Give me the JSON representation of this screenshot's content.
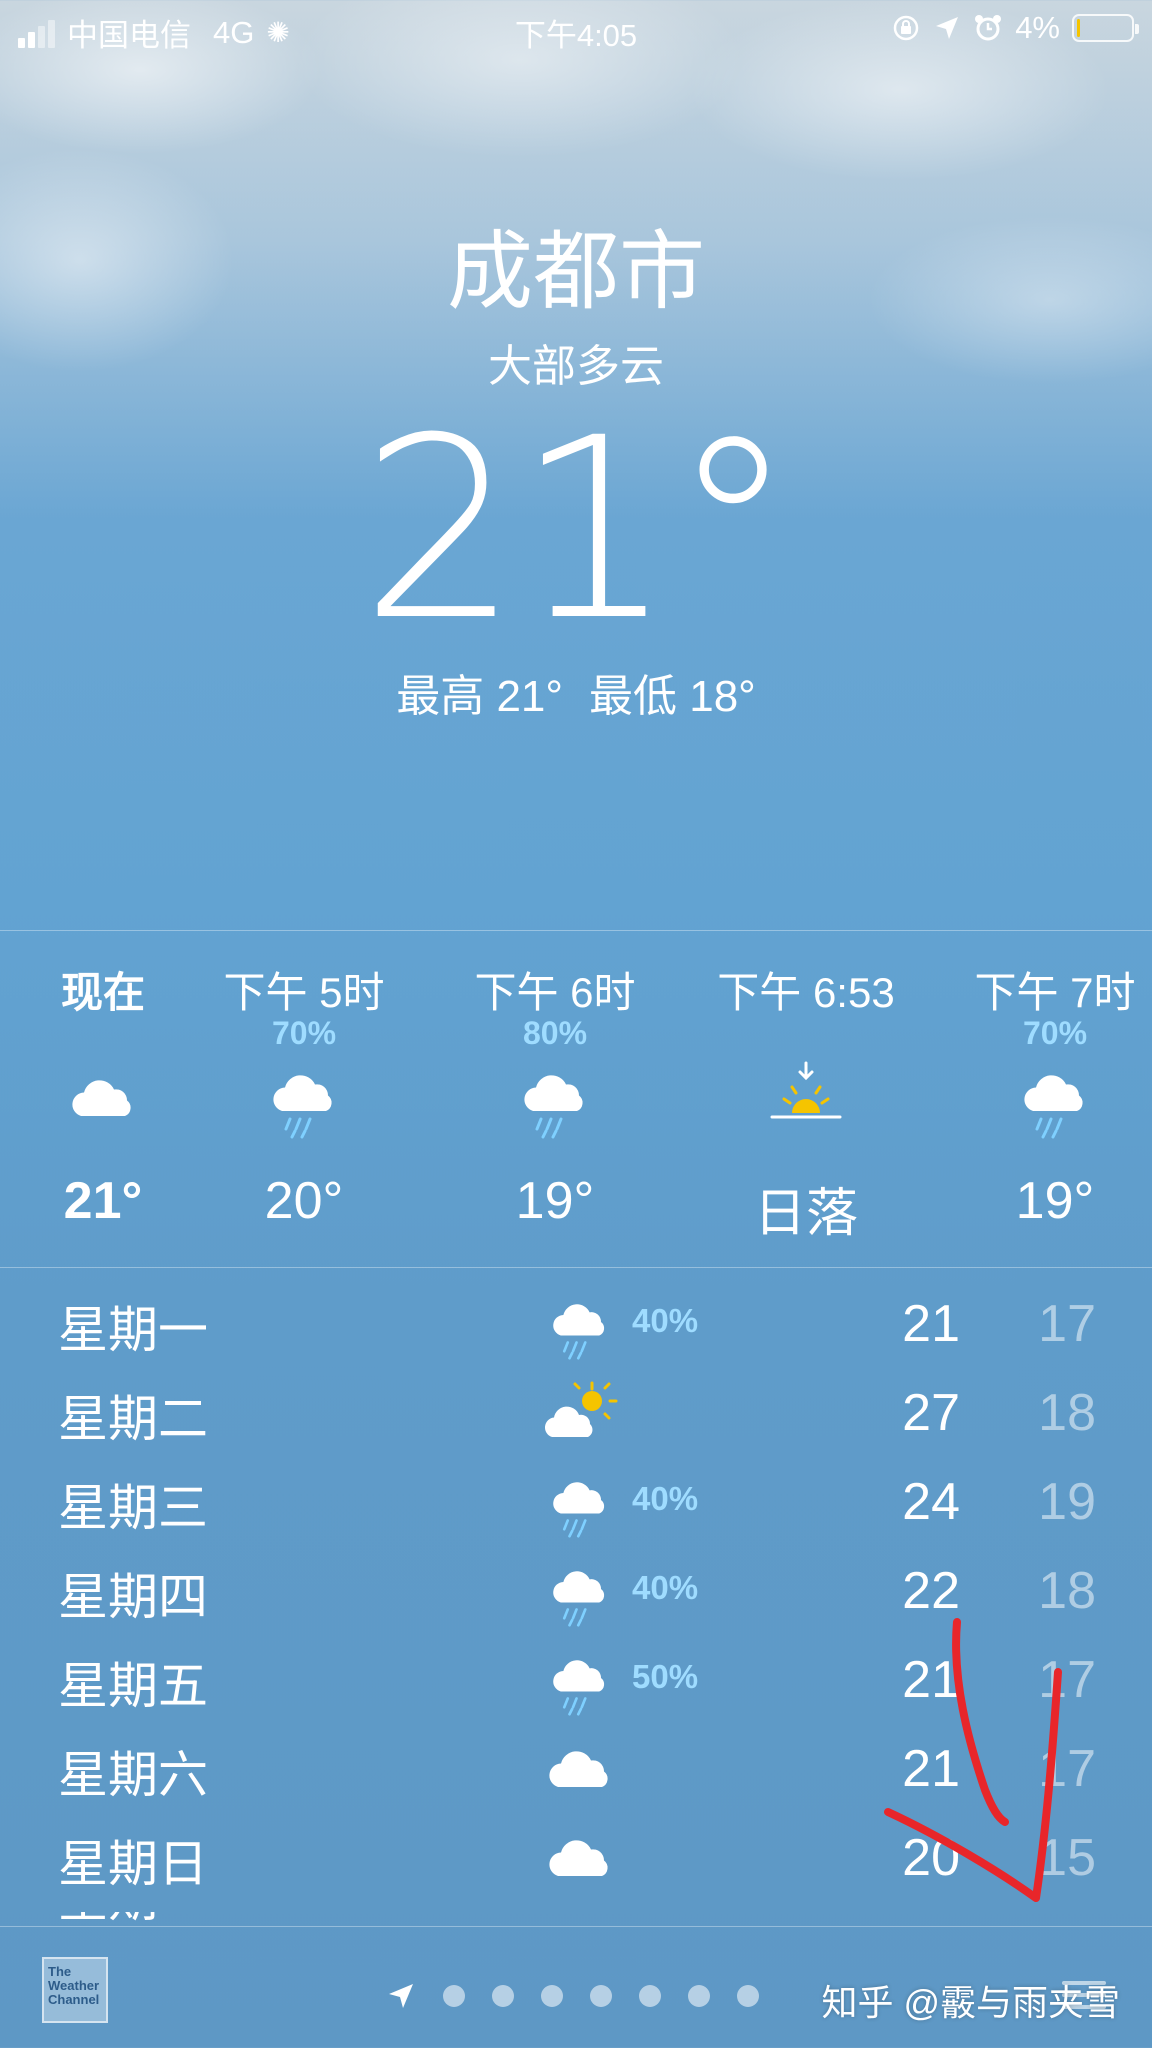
{
  "status_bar": {
    "carrier": "中国电信",
    "network": "4G",
    "time": "下午4:05",
    "battery_text": "4%",
    "battery_level": 0.04
  },
  "header": {
    "city": "成都市",
    "condition": "大部多云",
    "temperature": "21°",
    "high": "最高 21°",
    "low": "最低 18°"
  },
  "hourly": [
    {
      "label": "现在",
      "pct": "",
      "icon": "cloud-icon",
      "temp": "21°",
      "bold": true
    },
    {
      "label": "下午 5时",
      "pct": "70%",
      "icon": "rain-cloud-icon",
      "temp": "20°",
      "bold": false
    },
    {
      "label": "下午 6时",
      "pct": "80%",
      "icon": "rain-cloud-icon",
      "temp": "19°",
      "bold": false
    },
    {
      "label": "下午 6:53",
      "pct": "",
      "icon": "sunset-icon",
      "temp": "日落",
      "bold": false
    },
    {
      "label": "下午 7时",
      "pct": "70%",
      "icon": "rain-cloud-icon",
      "temp": "19°",
      "bold": false
    }
  ],
  "daily": [
    {
      "day": "星期一",
      "icon": "rain-cloud-icon",
      "pct": "40%",
      "high": "21",
      "low": "17"
    },
    {
      "day": "星期二",
      "icon": "partly-sunny-icon",
      "pct": "",
      "high": "27",
      "low": "18"
    },
    {
      "day": "星期三",
      "icon": "rain-cloud-icon",
      "pct": "40%",
      "high": "24",
      "low": "19"
    },
    {
      "day": "星期四",
      "icon": "rain-cloud-icon",
      "pct": "40%",
      "high": "22",
      "low": "18"
    },
    {
      "day": "星期五",
      "icon": "rain-cloud-icon",
      "pct": "50%",
      "high": "21",
      "low": "17"
    },
    {
      "day": "星期六",
      "icon": "cloud-icon",
      "pct": "",
      "high": "21",
      "low": "17"
    },
    {
      "day": "星期日",
      "icon": "cloud-icon",
      "pct": "",
      "high": "20",
      "low": "15"
    }
  ],
  "partial_row": "星期",
  "bottom_bar": {
    "logo_text": "The Weather Channel",
    "page_count": 7,
    "icons": [
      "location-arrow-icon",
      "list-icon"
    ]
  },
  "watermark": "知乎 @霰与雨夹雪",
  "colors": {
    "precip_blue": "#9fdcff",
    "sun_yellow": "#f5c400",
    "annotation_red": "#e8262a"
  }
}
